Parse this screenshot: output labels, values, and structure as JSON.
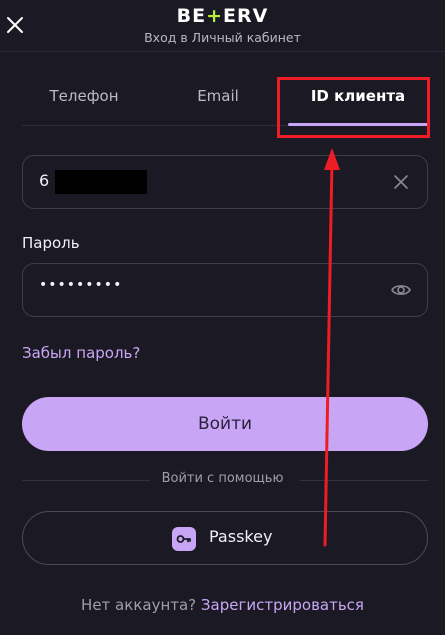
{
  "header": {
    "logo_part1": "BE",
    "logo_plus": "+",
    "logo_part2": "ERV",
    "subtitle": "Вход в Личный кабинет",
    "close_icon": "close-icon"
  },
  "tabs": [
    {
      "label": "Телефон",
      "active": false
    },
    {
      "label": "Email",
      "active": false
    },
    {
      "label": "ID клиента",
      "active": true
    }
  ],
  "client_id_field": {
    "value": "6"
  },
  "password": {
    "label": "Пароль",
    "value": "•••••••••"
  },
  "forgot_link": "Забыл пароль?",
  "login_button": "Войти",
  "divider_text": "Войти с помощью",
  "passkey_button": "Passkey",
  "signup": {
    "question": "Нет аккаунта?",
    "link": "Зарегистрироваться"
  },
  "colors": {
    "background": "#1b1a24",
    "accent": "#c9a6f5",
    "logo_plus": "#b7f03a",
    "annotation": "#ee1c25"
  }
}
